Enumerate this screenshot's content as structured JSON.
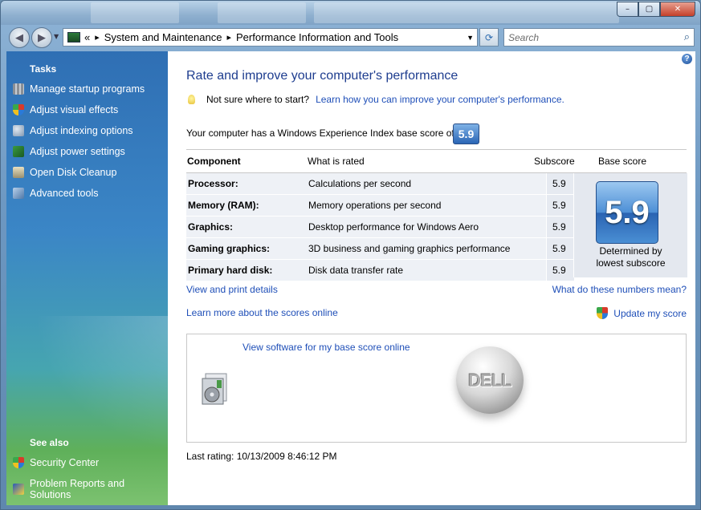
{
  "window": {
    "caption_buttons": {
      "minimize": "–",
      "maximize": "▢",
      "close": "✕"
    }
  },
  "address_bar": {
    "back_icon": "back-arrow-icon",
    "forward_icon": "forward-arrow-icon",
    "overflow": "«",
    "breadcrumb": [
      "System and Maintenance",
      "Performance Information and Tools"
    ],
    "separator": "▸",
    "refresh_icon": "refresh-icon",
    "search_placeholder": "Search"
  },
  "sidebar": {
    "tasks_heading": "Tasks",
    "tasks": [
      {
        "label": "Manage startup programs",
        "icon": "startup-icon",
        "color": "#8a8f96"
      },
      {
        "label": "Adjust visual effects",
        "icon": "shield-icon",
        "color": "#d9a030"
      },
      {
        "label": "Adjust indexing options",
        "icon": "indexing-icon",
        "color": "#a7b6c8"
      },
      {
        "label": "Adjust power settings",
        "icon": "power-icon",
        "color": "#3a9a40"
      },
      {
        "label": "Open Disk Cleanup",
        "icon": "disk-cleanup-icon",
        "color": "#c9c0a0"
      },
      {
        "label": "Advanced tools",
        "icon": "tools-icon",
        "color": "#7fa0c8"
      }
    ],
    "see_also_heading": "See also",
    "see_also": [
      {
        "label": "Security Center",
        "icon": "security-shield-icon"
      },
      {
        "label": "Problem Reports and Solutions",
        "icon": "problem-reports-icon"
      }
    ]
  },
  "main": {
    "title": "Rate and improve your computer's performance",
    "tip_text": "Not sure where to start?",
    "tip_link": "Learn how you can improve your computer's performance.",
    "wei_text": "Your computer has a Windows Experience Index base score of",
    "wei_score": "5.9",
    "table": {
      "headers": {
        "component": "Component",
        "what": "What is rated",
        "subscore": "Subscore",
        "base": "Base score"
      },
      "rows": [
        {
          "component": "Processor:",
          "what": "Calculations per second",
          "subscore": "5.9"
        },
        {
          "component": "Memory (RAM):",
          "what": "Memory operations per second",
          "subscore": "5.9"
        },
        {
          "component": "Graphics:",
          "what": "Desktop performance for Windows Aero",
          "subscore": "5.9"
        },
        {
          "component": "Gaming graphics:",
          "what": "3D business and gaming graphics performance",
          "subscore": "5.9"
        },
        {
          "component": "Primary hard disk:",
          "what": "Disk data transfer rate",
          "subscore": "5.9"
        }
      ],
      "base_score": "5.9",
      "base_caption_1": "Determined by",
      "base_caption_2": "lowest subscore"
    },
    "links": {
      "view_print": "View and print details",
      "what_numbers": "What do these numbers mean?",
      "learn_more": "Learn more about the scores online",
      "update": "Update my score"
    },
    "panel": {
      "link": "View software for my base score online",
      "logo_text": "DELL"
    },
    "last_rating": "Last rating: 10/13/2009 8:46:12 PM"
  },
  "colors": {
    "link": "#1f4fb8",
    "title": "#1e3d8f",
    "sidebar_top": "#2f6fb4",
    "sidebar_bottom": "#7cc270"
  }
}
